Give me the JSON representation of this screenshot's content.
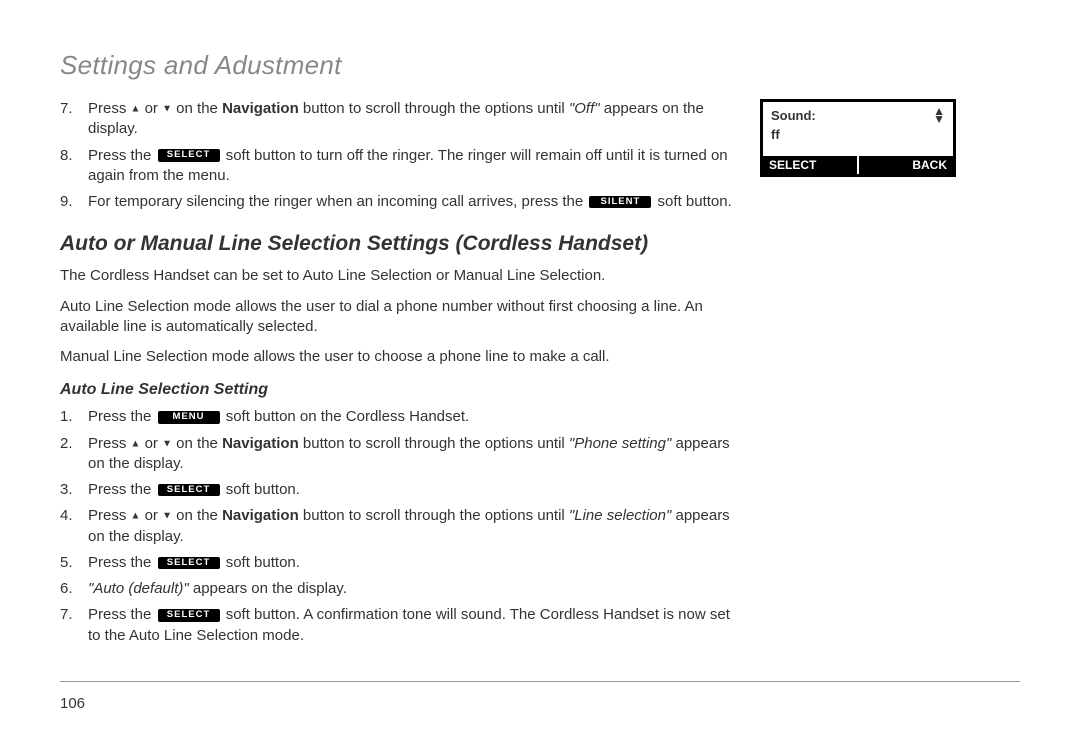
{
  "section_title": "Settings and Adustment",
  "soft_buttons": {
    "select": "SELECT",
    "silent": "SILENT",
    "menu": "MENU"
  },
  "nav_word": "Navigation",
  "upper_list": [
    {
      "pre": "Press ",
      "mid_a": " or ",
      "mid_b": " on the ",
      "mid_c": " button to scroll through the options until ",
      "quote": "\"Off\"",
      "post": " appears on the display."
    },
    {
      "pre": "Press the ",
      "post": " soft button to turn off the ringer. The ringer will remain off until it is turned on again from the menu."
    },
    {
      "pre": "For temporary silencing the ringer when an incoming call arrives, press the ",
      "post": " soft button."
    }
  ],
  "subheading1": "Auto or Manual Line Selection Settings (Cordless Handset)",
  "paras": [
    "The Cordless Handset can be set to Auto Line Selection or Manual Line Selection.",
    "Auto Line Selection mode allows the user to dial a phone number without first choosing a line. An available line is automatically selected.",
    "Manual Line Selection mode allows the user to choose a phone line to make a call."
  ],
  "subheading2": "Auto Line Selection Setting",
  "lower_list": {
    "s1_pre": "Press the ",
    "s1_post": " soft button on the Cordless Handset.",
    "s2_pre": "Press ",
    "s2_a": " or ",
    "s2_b": " on the ",
    "s2_c": " button to scroll through the options until ",
    "s2_quote": "\"Phone setting\"",
    "s2_post": " appears on the display.",
    "s3_pre": "Press the ",
    "s3_post": " soft button.",
    "s4_pre": "Press ",
    "s4_a": " or ",
    "s4_b": " on the ",
    "s4_c": " button to scroll through the options until ",
    "s4_quote": "\"Line selection\"",
    "s4_post": " appears on the display.",
    "s5_pre": "Press the ",
    "s5_post": " soft button.",
    "s6_quote": "\"Auto (default)\"",
    "s6_post": " appears on the display.",
    "s7_pre": "Press the ",
    "s7_post": " soft button. A confirmation tone will sound. The Cordless Handset is now set to the Auto Line Selection mode."
  },
  "screen": {
    "label": "Sound:",
    "value": "ff",
    "left": "SELECT",
    "right": "BACK"
  },
  "page_number": "106"
}
